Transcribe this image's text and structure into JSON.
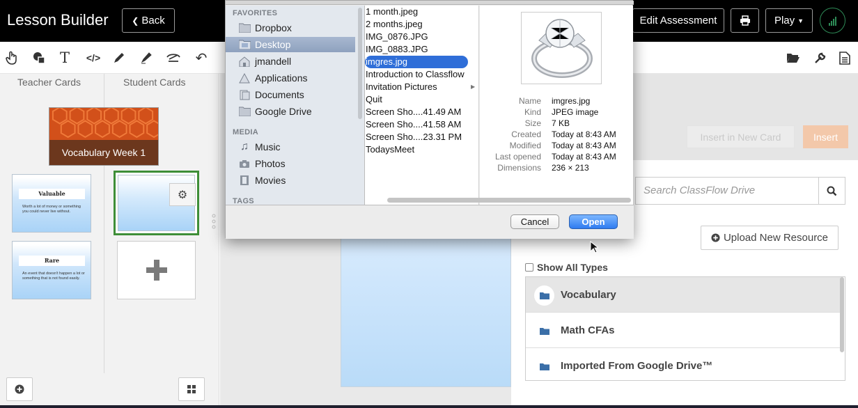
{
  "app": {
    "title": "Lesson Builder",
    "back_label": "Back",
    "edit_assessment_label": "Edit Assessment",
    "play_label": "Play"
  },
  "toolbar": {
    "tools": [
      "hand-pointer-icon",
      "shapes-icon",
      "text-icon",
      "code-icon",
      "pen-icon",
      "highlighter-icon",
      "eraser-icon",
      "undo-icon"
    ],
    "right_tools": [
      "folder-open-icon",
      "wrench-icon",
      "document-icon"
    ]
  },
  "left_panel": {
    "teacher_cards_label": "Teacher Cards",
    "student_cards_label": "Student Cards",
    "cover_title": "Vocabulary Week 1",
    "cards": [
      {
        "title": "Valuable",
        "text": "Worth a lot of money or something you could never live without."
      },
      {
        "title": "Rare",
        "text": "An event that doesn't happen a lot or something that is not found easily."
      }
    ]
  },
  "right_panel": {
    "insert_new_card_label": "Insert in New Card",
    "insert_label": "Insert",
    "search_placeholder": "Search ClassFlow Drive",
    "upload_label": "Upload New Resource",
    "show_all_types_label": "Show All Types",
    "folders": [
      "Vocabulary",
      "Math CFAs",
      "Imported From Google Drive™"
    ]
  },
  "dialog": {
    "sidebar": {
      "favorites_header": "FAVORITES",
      "favorites": [
        "Dropbox",
        "Desktop",
        "jmandell",
        "Applications",
        "Documents",
        "Google Drive"
      ],
      "selected_favorite": "Desktop",
      "media_header": "MEDIA",
      "media": [
        "Music",
        "Photos",
        "Movies"
      ],
      "tags_header": "TAGS"
    },
    "files": [
      "1 month.jpeg",
      "2 months.jpeg",
      "IMG_0876.JPG",
      "IMG_0883.JPG",
      "imgres.jpg",
      "Introduction to Classflow",
      "Invitation Pictures",
      "Quit",
      "Screen Sho....41.49 AM",
      "Screen Sho....41.58 AM",
      "Screen Sho....23.31 PM",
      "TodaysMeet"
    ],
    "selected_file": "imgres.jpg",
    "info": {
      "name_key": "Name",
      "name": "imgres.jpg",
      "kind_key": "Kind",
      "kind": "JPEG image",
      "size_key": "Size",
      "size": "7 KB",
      "created_key": "Created",
      "created": "Today at 8:43 AM",
      "modified_key": "Modified",
      "modified": "Today at 8:43 AM",
      "opened_key": "Last opened",
      "opened": "Today at 8:43 AM",
      "dimensions_key": "Dimensions",
      "dimensions": "236 × 213"
    },
    "cancel_label": "Cancel",
    "open_label": "Open"
  },
  "colors": {
    "topbar": "#000000",
    "selected_card_border": "#3e8e37",
    "insert_button": "#f3c8aa",
    "mac_selection": "#2f6ed8",
    "folder_icon": "#3b6fa8"
  }
}
